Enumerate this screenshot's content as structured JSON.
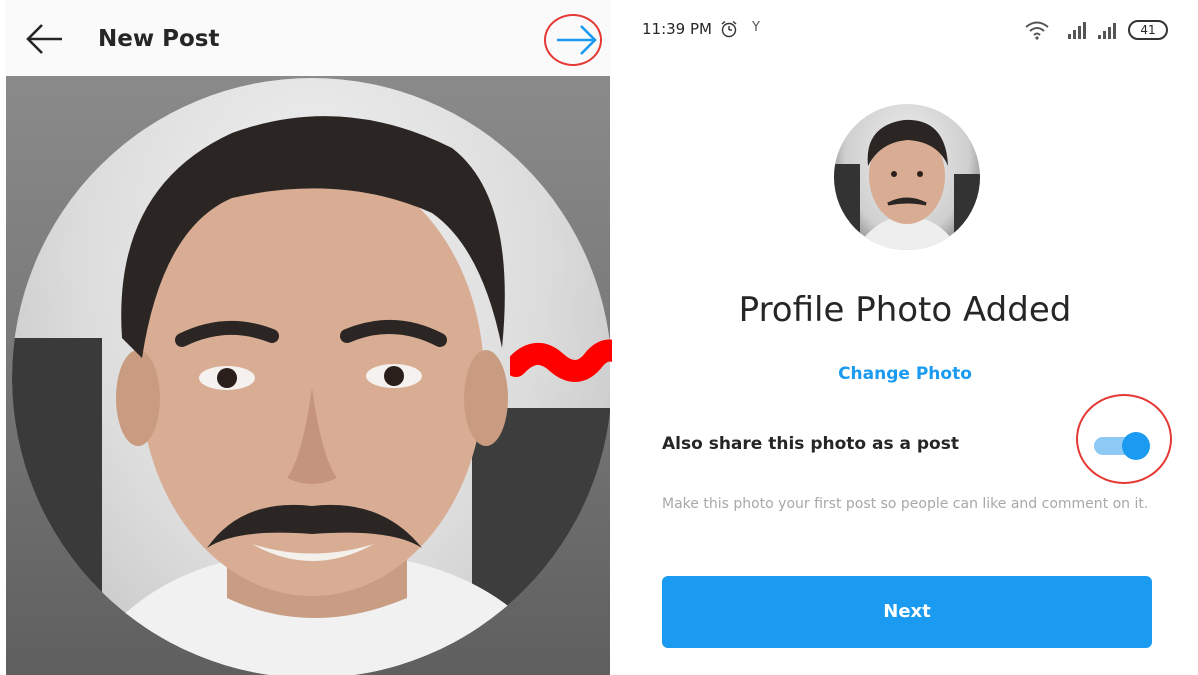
{
  "left": {
    "title": "New Post",
    "icons": {
      "back": "arrow-left-icon",
      "next": "arrow-right-icon"
    },
    "colors": {
      "next_arrow": "#1a9af0",
      "highlight_ring": "#e53935"
    }
  },
  "right": {
    "status_bar": {
      "time": "11:39 PM",
      "carrier_mark": "Y",
      "battery": "41",
      "icons": [
        "alarm-icon",
        "wifi-icon",
        "signal-icon",
        "signal-icon",
        "battery-icon"
      ]
    },
    "title": "Profile Photo Added",
    "change_photo": "Change Photo",
    "share_label": "Also share this photo as a post",
    "share_toggle_on": true,
    "share_desc": "Make this photo your first post so people can like and comment on it.",
    "next_button": "Next",
    "colors": {
      "accent": "#1a9af0",
      "highlight_ring": "#e53935"
    }
  },
  "annotation": {
    "arrow_color": "#ff0000"
  }
}
